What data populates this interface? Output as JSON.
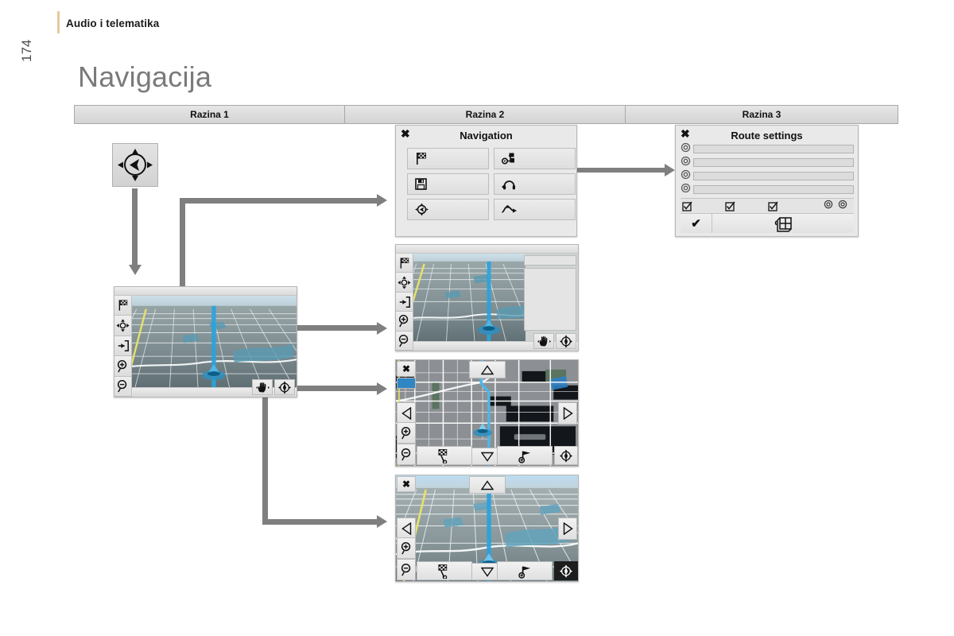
{
  "header": {
    "section_title": "Audio i telematika",
    "page_number": "174",
    "chapter_title": "Navigacija"
  },
  "levels": [
    {
      "label": "Razina 1"
    },
    {
      "label": "Razina 2"
    },
    {
      "label": "Razina 3"
    }
  ],
  "joystick": {
    "name": "navigation-joystick",
    "center_icon": "navigation-pointer-icon",
    "arrows": [
      "up-arrow-icon",
      "right-arrow-icon",
      "down-arrow-icon",
      "left-arrow-icon"
    ]
  },
  "nav_menu": {
    "title": "Navigation",
    "close_label": "✖",
    "buttons": [
      {
        "icon": "checkered-flag-icon",
        "label": ""
      },
      {
        "icon": "route-settings-icon",
        "label": ""
      },
      {
        "icon": "floppy-save-icon",
        "label": ""
      },
      {
        "icon": "headphones-icon",
        "label": ""
      },
      {
        "icon": "compass-pointer-icon",
        "label": ""
      },
      {
        "icon": "detour-route-icon",
        "label": ""
      }
    ]
  },
  "route_settings": {
    "title": "Route settings",
    "close_label": "✖",
    "option_rows": [
      {
        "icon": "radio-button-icon",
        "label": ""
      },
      {
        "icon": "radio-button-icon",
        "label": ""
      },
      {
        "icon": "radio-button-icon",
        "label": ""
      },
      {
        "icon": "radio-button-icon",
        "label": ""
      }
    ],
    "check_row": [
      {
        "icon": "checkbox-checked-icon"
      },
      {
        "icon": "checkbox-checked-icon"
      },
      {
        "icon": "checkbox-checked-icon"
      },
      {
        "icon": "radio-button-icon"
      },
      {
        "icon": "radio-button-icon"
      }
    ],
    "confirm_label": "✔",
    "map_icon": "map-grid-hand-icon"
  },
  "map_main": {
    "name": "map-screen-level-1",
    "view": "3d-perspective",
    "rail_icons": [
      "checkered-flag-icon",
      "pan-move-icon",
      "exit-icon",
      "zoom-in-icon",
      "zoom-out-icon"
    ],
    "corner_icons": [
      "hand-pan-icon",
      "compass-rose-icon"
    ]
  },
  "map_split": {
    "name": "map-screen-split-view",
    "view": "3d-perspective-with-info-panel",
    "rail_icons": [
      "checkered-flag-icon",
      "pan-move-icon",
      "exit-icon",
      "zoom-in-icon",
      "zoom-out-icon"
    ],
    "corner_icons": [
      "hand-pan-icon",
      "compass-rose-icon"
    ]
  },
  "map_2d": {
    "name": "map-screen-2d-pan",
    "view": "2d-dark",
    "close_label": "✖",
    "pan_icons": [
      "pan-up-icon",
      "pan-down-icon",
      "pan-left-icon",
      "pan-right-icon"
    ],
    "zoom_icons": [
      "zoom-in-icon",
      "zoom-out-icon"
    ],
    "bottom_icons": [
      "checkered-flag-icon",
      "route-flag-icon",
      "compass-rose-icon"
    ]
  },
  "map_3d": {
    "name": "map-screen-3d-pan",
    "view": "3d-perspective",
    "close_label": "✖",
    "pan_icons": [
      "pan-up-icon",
      "pan-down-icon",
      "pan-left-icon",
      "pan-right-icon"
    ],
    "zoom_icons": [
      "zoom-in-icon",
      "zoom-out-icon"
    ],
    "bottom_icons": [
      "checkered-flag-icon",
      "route-flag-icon",
      "compass-rose-icon"
    ]
  },
  "colors": {
    "arrow": "#7f7f7f",
    "accent_rule": "#e8c89a",
    "title_gray": "#7a7a7a",
    "route_blue": "#29a3dc",
    "road_yellow": "#e8e26a",
    "panel_bg": "#e9e9e9"
  }
}
